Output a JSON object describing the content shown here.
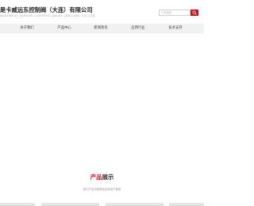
{
  "header": {
    "company_name": "是卡威远东控制阀（大连）有限公司",
    "company_name_en": "SKAYWEST FARFAR CONTROL VALVE (DALIAN) CO.,LTD"
  },
  "search": {
    "placeholder": "产品搜索",
    "icon": "search-icon",
    "button_color": "#c8161d"
  },
  "nav": {
    "items": [
      {
        "label": "关于我们"
      },
      {
        "label": "产品中心"
      },
      {
        "label": "新闻资讯"
      },
      {
        "label": "应用行业"
      },
      {
        "label": "技术支持"
      }
    ]
  },
  "products": {
    "title_accent": "产品",
    "title_rest": "展示",
    "subtitle": "我们产品将推荐给全球用户使用",
    "accent_color": "#c8161d"
  }
}
